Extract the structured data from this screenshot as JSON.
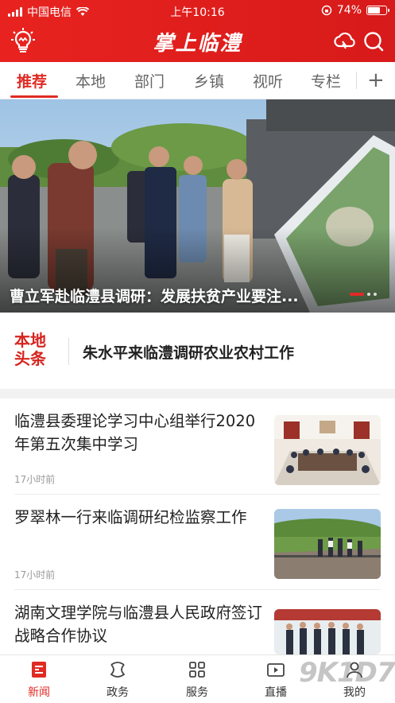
{
  "status": {
    "carrier": "中国电信",
    "time": "上午10:16",
    "battery": "74%",
    "battery_level": 0.74
  },
  "appbar": {
    "title": "掌上临澧"
  },
  "tabs": [
    "推荐",
    "本地",
    "部门",
    "乡镇",
    "视听",
    "专栏"
  ],
  "active_tab": 0,
  "hero": {
    "caption": "曹立军赴临澧县调研：发展扶贫产业要注...",
    "slide_count": 3,
    "active_slide": 0
  },
  "headline": {
    "badge_line1": "本地",
    "badge_line2": "头条",
    "text": "朱水平来临澧调研农业农村工作"
  },
  "news": [
    {
      "title": "临澧县委理论学习中心组举行2020年第五次集中学习",
      "time": "17小时前"
    },
    {
      "title": "罗翠林一行来临调研纪检监察工作",
      "time": "17小时前"
    },
    {
      "title": "湖南文理学院与临澧县人民政府签订战略合作协议",
      "time": ""
    }
  ],
  "bottom_nav": [
    "新闻",
    "政务",
    "服务",
    "直播",
    "我的"
  ],
  "watermark": "9K1D7",
  "colors": {
    "accent": "#e02b24"
  },
  "icons": {
    "logo": "lightbulb-icon",
    "cloud": "cloud-icon",
    "search": "search-icon"
  }
}
